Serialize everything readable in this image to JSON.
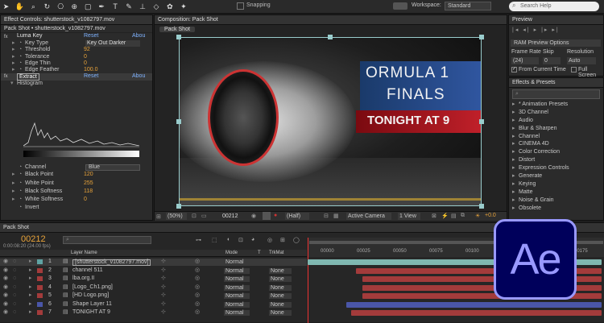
{
  "toolbar": {
    "snapping": "Snapping",
    "workspace_label": "Workspace:",
    "workspace_value": "Standard",
    "search_placeholder": "Search Help"
  },
  "effect_controls": {
    "tab": "Effect Controls: shutterstock_v1082797.mov",
    "path": "Pack Shot • shutterstock_v1082797.mov",
    "luma_key": {
      "title": "Luma Key",
      "reset": "Reset",
      "about": "Abou"
    },
    "props": [
      {
        "label": "Key Type",
        "value": "Key Out Darker"
      },
      {
        "label": "Threshold",
        "value": "92"
      },
      {
        "label": "Tolerance",
        "value": "0"
      },
      {
        "label": "Edge Thin",
        "value": "0"
      },
      {
        "label": "Edge Feather",
        "value": "100.0"
      }
    ],
    "extract": {
      "title": "Extract",
      "reset": "Reset",
      "about": "Abou"
    },
    "histogram": "Histogram",
    "channel": {
      "label": "Channel",
      "value": "Blue"
    },
    "props2": [
      {
        "label": "Black Point",
        "value": "120"
      },
      {
        "label": "White Point",
        "value": "255"
      },
      {
        "label": "Black Softness",
        "value": "118"
      },
      {
        "label": "White Softness",
        "value": "0"
      },
      {
        "label": "Invert",
        "value": ""
      }
    ]
  },
  "composition": {
    "tab": "Composition: Pack Shot",
    "subtab": "Pack Shot",
    "title_line1": "ORMULA 1",
    "title_line2": "FINALS",
    "title_line3": "TONIGHT AT 9",
    "zoom": "(50%)",
    "timecode": "00212",
    "resolution": "(Half)",
    "camera": "Active Camera",
    "view": "1 View",
    "exposure": "+0.0"
  },
  "preview": {
    "tab": "Preview",
    "ram_options": "RAM Preview Options",
    "frame_rate_label": "Frame Rate",
    "skip_label": "Skip",
    "resolution_label": "Resolution",
    "frame_rate": "(24)",
    "skip": "0",
    "resolution": "Auto",
    "from_current": "From Current Time",
    "full_screen": "Full Screen"
  },
  "effects_presets": {
    "tab": "Effects & Presets",
    "items": [
      "* Animation Presets",
      "3D Channel",
      "Audio",
      "Blur & Sharpen",
      "Channel",
      "CINEMA 4D",
      "Color Correction",
      "Distort",
      "Expression Controls",
      "Generate",
      "Keying",
      "Matte",
      "Noise & Grain",
      "Obsolete"
    ]
  },
  "timeline": {
    "tab": "Pack Shot",
    "timecode": "00212",
    "timecode_sub": "0:00:08:20 (24.00 fps)",
    "col_layer_name": "Layer Name",
    "col_mode": "Mode",
    "col_t": "T",
    "col_trkmat": "TrkMat",
    "ruler": [
      "00000",
      "00025",
      "00050",
      "00075",
      "00100",
      "00125",
      "00150",
      "00175",
      "00200"
    ],
    "layers": [
      {
        "num": "1",
        "name": "[shutterstock_v1082797.mov]",
        "mode": "Normal",
        "trkmat": "",
        "label": "#5fa3a3"
      },
      {
        "num": "2",
        "name": "channel 511",
        "mode": "Normal",
        "trkmat": "None",
        "label": "#a33b3b"
      },
      {
        "num": "3",
        "name": "lba.org.II",
        "mode": "Normal",
        "trkmat": "None",
        "label": "#a33b3b"
      },
      {
        "num": "4",
        "name": "[Logo_Ch1.png]",
        "mode": "Normal",
        "trkmat": "None",
        "label": "#a33b3b"
      },
      {
        "num": "5",
        "name": "[HD Logo.png]",
        "mode": "Normal",
        "trkmat": "None",
        "label": "#a33b3b"
      },
      {
        "num": "6",
        "name": "Shape Layer 11",
        "mode": "Normal",
        "trkmat": "None",
        "label": "#4a56a8"
      },
      {
        "num": "7",
        "name": "TONIGHT AT 9",
        "mode": "Normal",
        "trkmat": "None",
        "label": "#a33b3b"
      }
    ]
  },
  "ae_logo": {
    "text": "Ae",
    "bg": "#00005b",
    "fg": "#9999ff"
  }
}
